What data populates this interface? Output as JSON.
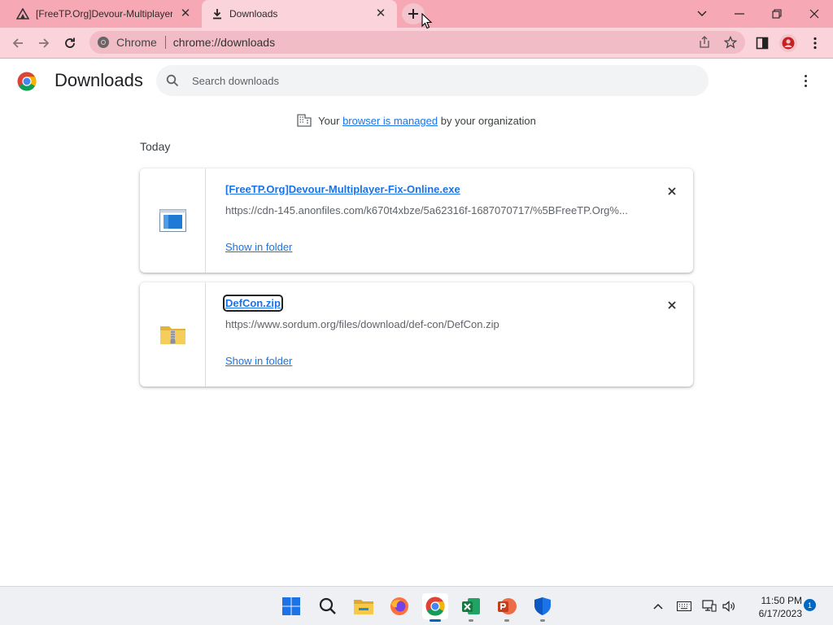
{
  "tabs": [
    {
      "title": "[FreeTP.Org]Devour-Multiplayer-Fix-Online",
      "icon": "freetp-favicon",
      "active": false
    },
    {
      "title": "Downloads",
      "icon": "download-icon",
      "active": true
    }
  ],
  "toolbar": {
    "site_chip": "Chrome",
    "url": "chrome://downloads"
  },
  "page": {
    "title": "Downloads",
    "search_placeholder": "Search downloads",
    "managed": {
      "prefix": "Your",
      "link": "browser is managed",
      "suffix": "by your organization"
    },
    "date_header": "Today"
  },
  "downloads": [
    {
      "filename": "[FreeTP.Org]Devour-Multiplayer-Fix-Online.exe",
      "url": "https://cdn-145.anonfiles.com/k670t4xbze/5a62316f-1687070717/%5BFreeTP.Org%...",
      "action": "Show in folder",
      "icon": "exe-file-icon"
    },
    {
      "filename": "DefCon.zip",
      "url": "https://www.sordum.org/files/download/def-con/DefCon.zip",
      "action": "Show in folder",
      "icon": "zip-folder-icon"
    }
  ],
  "taskbar": {
    "time": "11:50 PM",
    "date": "6/17/2023",
    "notifications": "1"
  },
  "colors": {
    "tabstrip": "#f7a8b5",
    "toolbar": "#fbd3db",
    "link": "#1a73e8",
    "taskbar": "#eef0f3"
  }
}
